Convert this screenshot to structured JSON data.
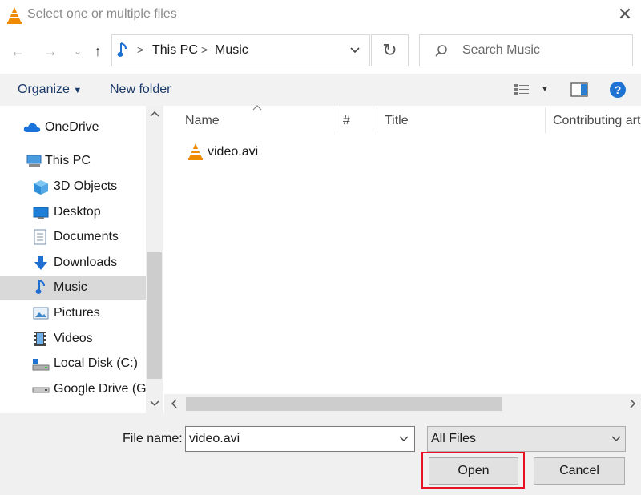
{
  "window": {
    "title": "Select one or multiple files"
  },
  "nav": {
    "back_icon": "arrow-left-icon",
    "forward_icon": "arrow-right-icon",
    "up_icon": "arrow-up-icon",
    "breadcrumb": [
      "This PC",
      "Music"
    ],
    "search_placeholder": "Search Music"
  },
  "toolbar": {
    "organize": "Organize",
    "new_folder": "New folder"
  },
  "sidebar": {
    "items": [
      {
        "label": "OneDrive",
        "icon": "cloud-icon"
      },
      {
        "label": "This PC",
        "icon": "computer-icon"
      },
      {
        "label": "3D Objects",
        "icon": "cube-icon"
      },
      {
        "label": "Desktop",
        "icon": "desktop-icon"
      },
      {
        "label": "Documents",
        "icon": "document-icon"
      },
      {
        "label": "Downloads",
        "icon": "download-icon"
      },
      {
        "label": "Music",
        "icon": "music-note-icon",
        "selected": true
      },
      {
        "label": "Pictures",
        "icon": "picture-icon"
      },
      {
        "label": "Videos",
        "icon": "film-icon"
      },
      {
        "label": "Local Disk (C:)",
        "icon": "disk-icon"
      },
      {
        "label": "Google Drive (G:",
        "icon": "drive-icon"
      }
    ]
  },
  "columns": [
    "Name",
    "#",
    "Title",
    "Contributing art"
  ],
  "files": [
    {
      "name": "video.avi",
      "icon": "vlc-cone-icon"
    }
  ],
  "bottom": {
    "file_name_label": "File name:",
    "file_name_value": "video.avi",
    "filter_value": "All Files",
    "open_label": "Open",
    "cancel_label": "Cancel"
  },
  "colors": {
    "accent": "#0078d7",
    "highlight": "#e81123",
    "vlc_orange": "#f08a00"
  }
}
